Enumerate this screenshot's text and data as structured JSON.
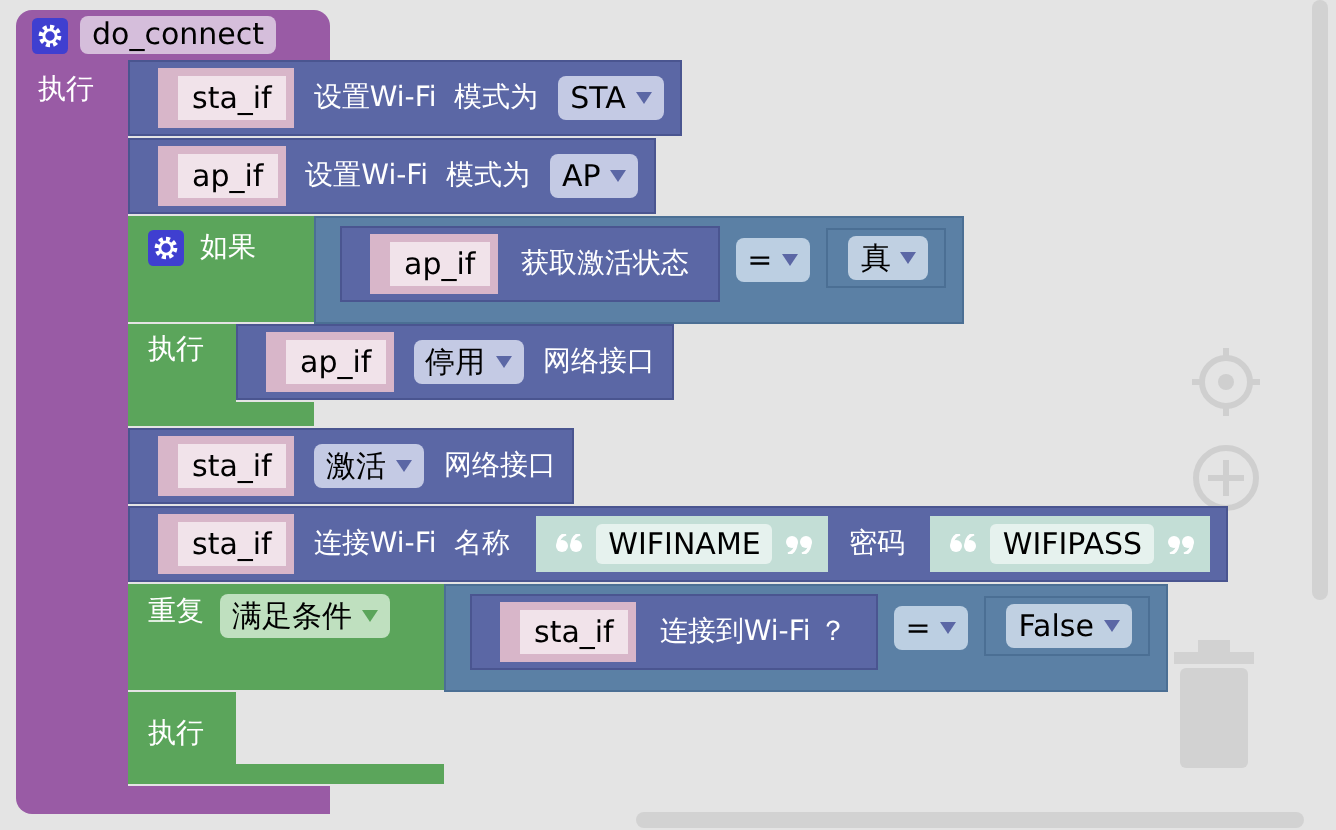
{
  "function": {
    "name": "do_connect",
    "do_label": "执行",
    "body": [
      {
        "kind": "statement",
        "parts": [
          {
            "kind": "variable",
            "text": "sta_if"
          },
          {
            "kind": "label",
            "text": "设置Wi-Fi  模式为"
          },
          {
            "kind": "dropdown",
            "text": "STA"
          }
        ]
      },
      {
        "kind": "statement",
        "parts": [
          {
            "kind": "variable",
            "text": "ap_if"
          },
          {
            "kind": "label",
            "text": "设置Wi-Fi  模式为"
          },
          {
            "kind": "dropdown",
            "text": "AP"
          }
        ]
      },
      {
        "kind": "if",
        "label": "如果",
        "condition": {
          "parts": [
            {
              "kind": "block",
              "parts": [
                {
                  "kind": "variable",
                  "text": "ap_if"
                },
                {
                  "kind": "label",
                  "text": "获取激活状态"
                }
              ]
            },
            {
              "kind": "dropdown",
              "text": "="
            },
            {
              "kind": "slot",
              "parts": [
                {
                  "kind": "dropdown",
                  "text": "真"
                }
              ]
            }
          ]
        },
        "do_label": "执行",
        "body": [
          {
            "kind": "statement",
            "parts": [
              {
                "kind": "variable",
                "text": "ap_if"
              },
              {
                "kind": "dropdown",
                "text": "停用"
              },
              {
                "kind": "label",
                "text": "网络接口"
              }
            ]
          }
        ]
      },
      {
        "kind": "statement",
        "parts": [
          {
            "kind": "variable",
            "text": "sta_if"
          },
          {
            "kind": "dropdown",
            "text": "激活"
          },
          {
            "kind": "label",
            "text": "网络接口"
          }
        ]
      },
      {
        "kind": "statement",
        "parts": [
          {
            "kind": "variable",
            "text": "sta_if"
          },
          {
            "kind": "label",
            "text": "连接Wi-Fi  名称"
          },
          {
            "kind": "text",
            "text": "WIFINAME"
          },
          {
            "kind": "label",
            "text": "密码"
          },
          {
            "kind": "text",
            "text": "WIFIPASS"
          }
        ]
      },
      {
        "kind": "repeat",
        "label": "重复",
        "mode": "满足条件",
        "condition": {
          "parts": [
            {
              "kind": "block",
              "parts": [
                {
                  "kind": "variable",
                  "text": "sta_if"
                },
                {
                  "kind": "label",
                  "text": "连接到Wi-Fi ？"
                }
              ]
            },
            {
              "kind": "dropdown",
              "text": "="
            },
            {
              "kind": "slot",
              "parts": [
                {
                  "kind": "dropdown",
                  "text": "False"
                }
              ]
            }
          ]
        },
        "do_label": "执行"
      }
    ]
  }
}
